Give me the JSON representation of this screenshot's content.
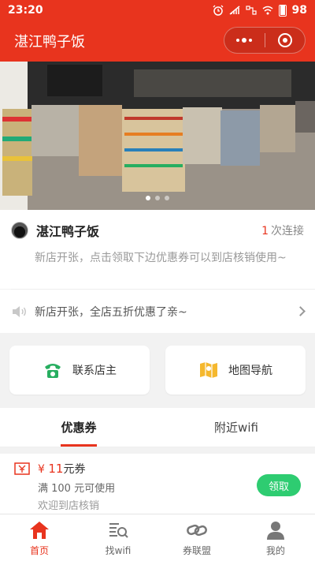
{
  "status_bar": {
    "time": "23:20",
    "battery": "98"
  },
  "app": {
    "title": "湛江鸭子饭"
  },
  "shop": {
    "name": "湛江鸭子饭",
    "connections_count": "1",
    "connections_label": "次连接",
    "description": "新店开张，点击领取下边优惠券可以到店核销使用~"
  },
  "notice": {
    "text": "新店开张，全店五折优惠了亲~"
  },
  "actions": {
    "contact": "联系店主",
    "map": "地图导航"
  },
  "tabs": [
    {
      "label": "优惠券",
      "active": true
    },
    {
      "label": "附近wifi",
      "active": false
    }
  ],
  "coupon": {
    "currency": "¥",
    "amount": "11",
    "unit": "元券",
    "condition": "满 100 元可使用",
    "note": "欢迎到店核销",
    "claim_label": "领取"
  },
  "bottom_nav": [
    {
      "label": "首页",
      "icon": "home-icon",
      "active": true
    },
    {
      "label": "找wifi",
      "icon": "search-list-icon",
      "active": false
    },
    {
      "label": "券联盟",
      "icon": "link-icon",
      "active": false
    },
    {
      "label": "我的",
      "icon": "user-icon",
      "active": false
    }
  ],
  "colors": {
    "brand": "#e8341e",
    "accent_green": "#2ecc71",
    "map_yellow": "#f5b82e"
  }
}
